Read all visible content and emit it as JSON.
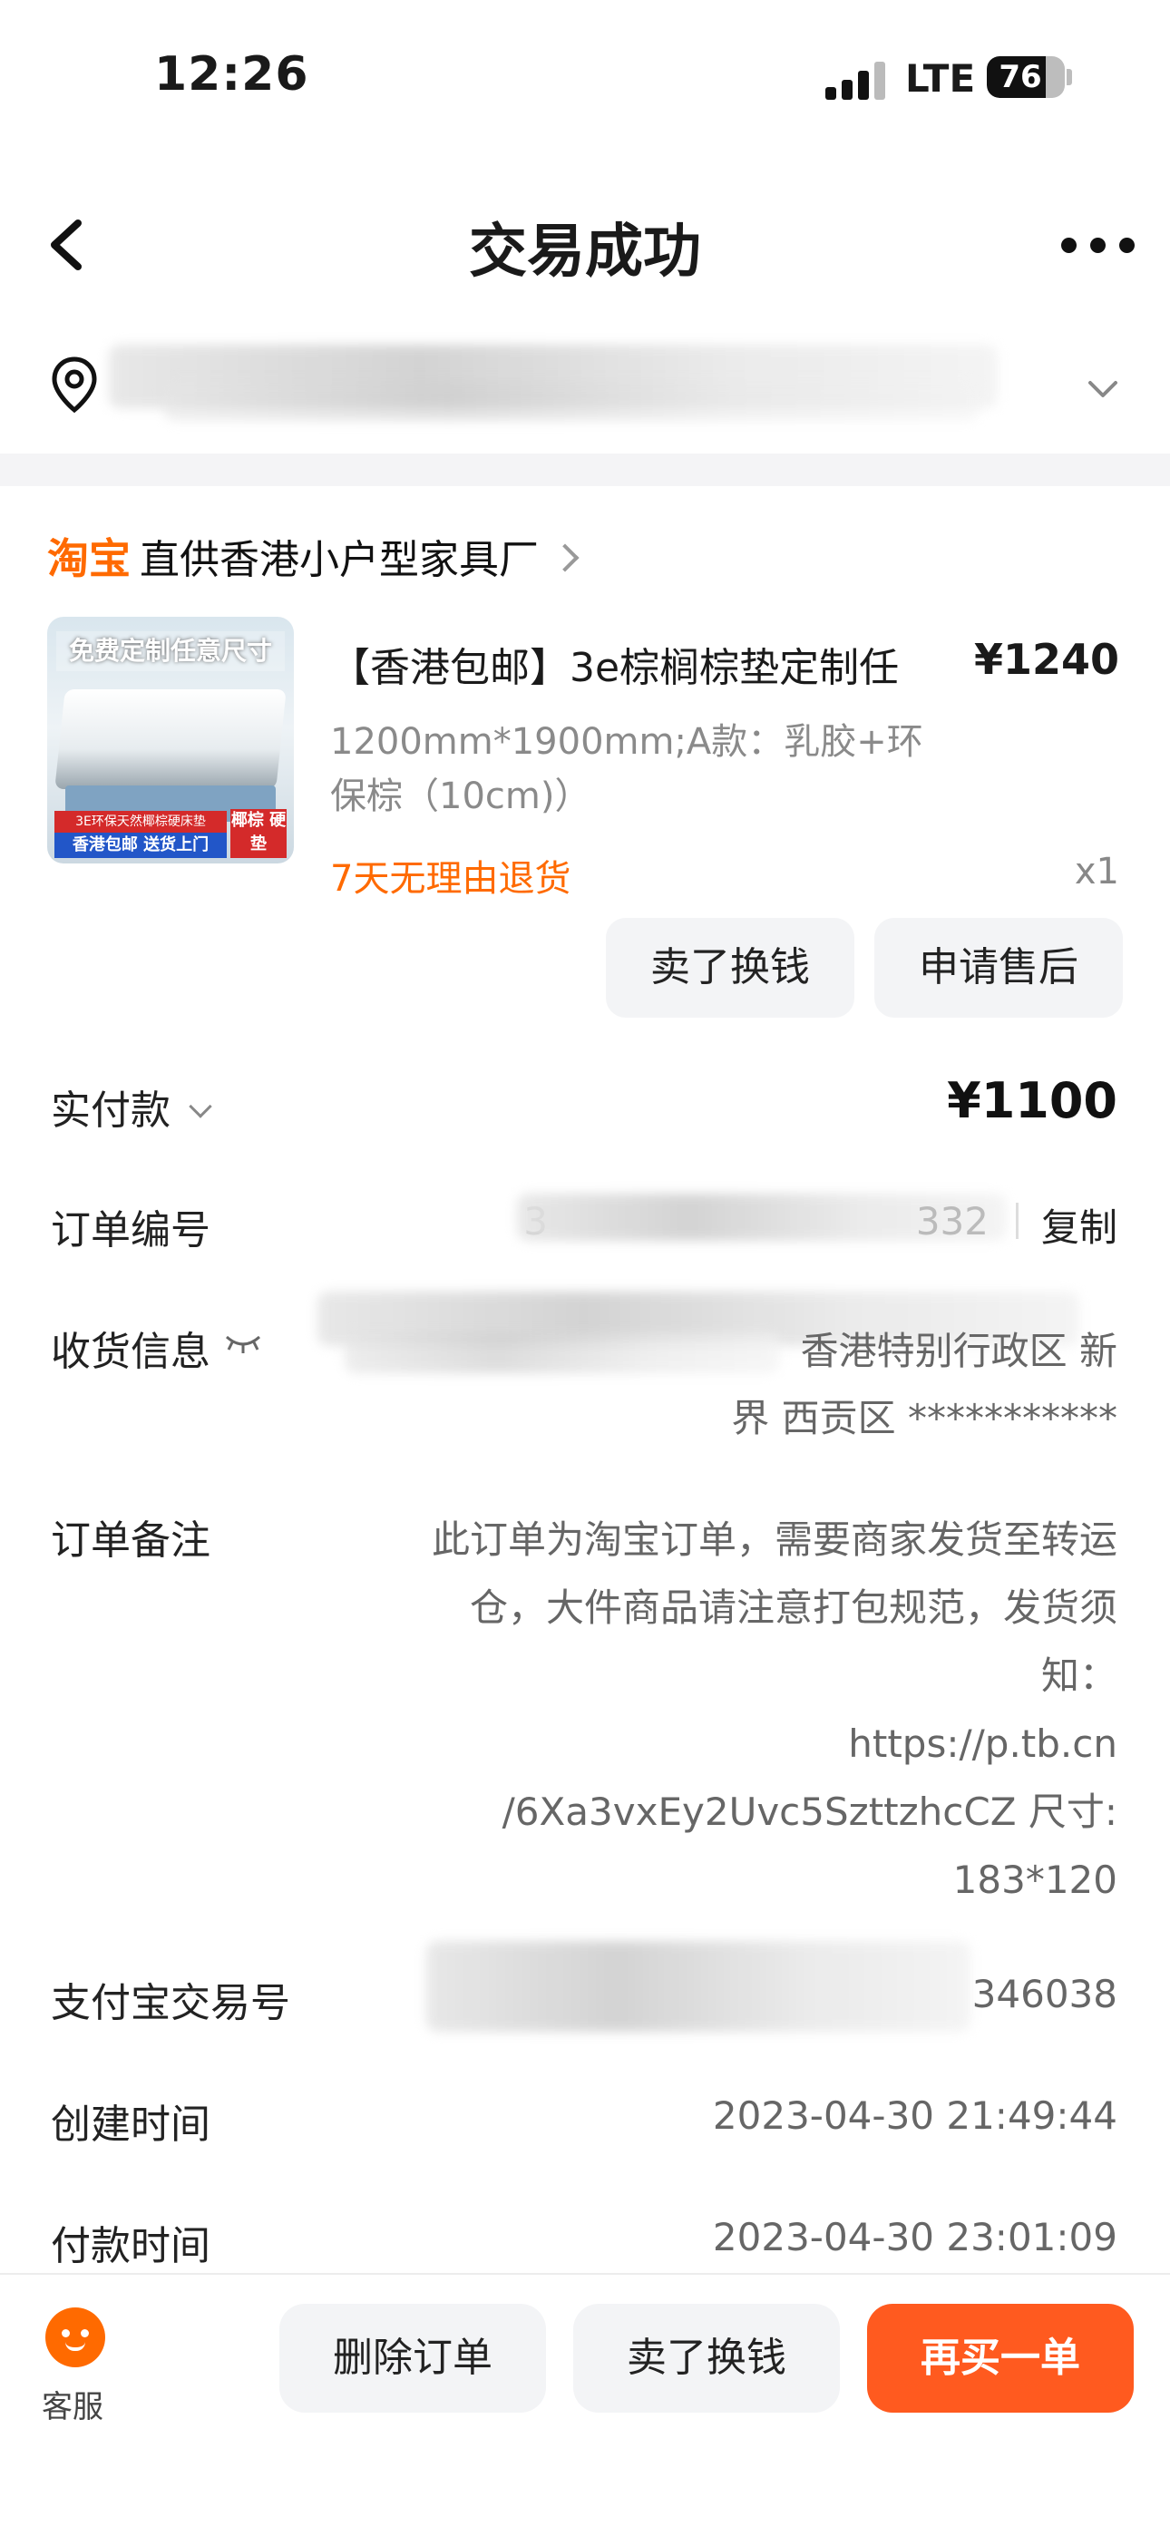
{
  "status_bar": {
    "time": "12:26",
    "network": "LTE",
    "battery": "76",
    "battery_level": 0.76
  },
  "header": {
    "title": "交易成功",
    "back_icon": "chevron-left-icon",
    "more_icon": "more-dots-icon"
  },
  "address": {
    "icon": "location-pin-icon",
    "expand_icon": "chevron-down-icon"
  },
  "shop": {
    "logo": "淘宝",
    "name": "直供香港小户型家具厂"
  },
  "product": {
    "title": "【香港包邮】3e棕榈棕垫定制任",
    "price": "¥1240",
    "spec_line1": "1200mm*1900mm;A款：乳胶+环",
    "spec_line2": "保棕（10cm)）",
    "return_policy": "7天无理由退货",
    "quantity": "x1",
    "thumb_banner": "免费定制任意尺寸",
    "thumb_strip": "3E环保天然椰棕硬床垫",
    "thumb_strip2": "香港包邮 送货上门",
    "thumb_tag": "椰棕 硬垫",
    "actions": [
      "卖了换钱",
      "申请售后"
    ]
  },
  "order_info": {
    "paid": {
      "label": "实付款",
      "value": "¥1100"
    },
    "order_no": {
      "label": "订单编号",
      "visible_part": "3",
      "visible_tail": "332",
      "copy": "复制"
    },
    "shipping": {
      "label": "收货信息",
      "line1": "香港特别行政区 新",
      "line2": "界 西贡区 ***********"
    },
    "remark": {
      "label": "订单备注",
      "lines": [
        "此订单为淘宝订单，需要商家发货至转运",
        "仓，大件商品请注意打包规范，发货须",
        "知：",
        "https://p.tb.cn",
        "/6Xa3vxEy2Uvc5SzttzhcCZ 尺寸:",
        "183*120"
      ]
    },
    "alipay_no": {
      "label": "支付宝交易号",
      "visible_tail": "346038"
    },
    "created": {
      "label": "创建时间",
      "value": "2023-04-30 21:49:44"
    },
    "paid_time": {
      "label": "付款时间",
      "value": "2023-04-30 23:01:09"
    }
  },
  "bottom_bar": {
    "service_label": "客服",
    "buttons": [
      "删除订单",
      "卖了换钱",
      "再买一单"
    ]
  }
}
